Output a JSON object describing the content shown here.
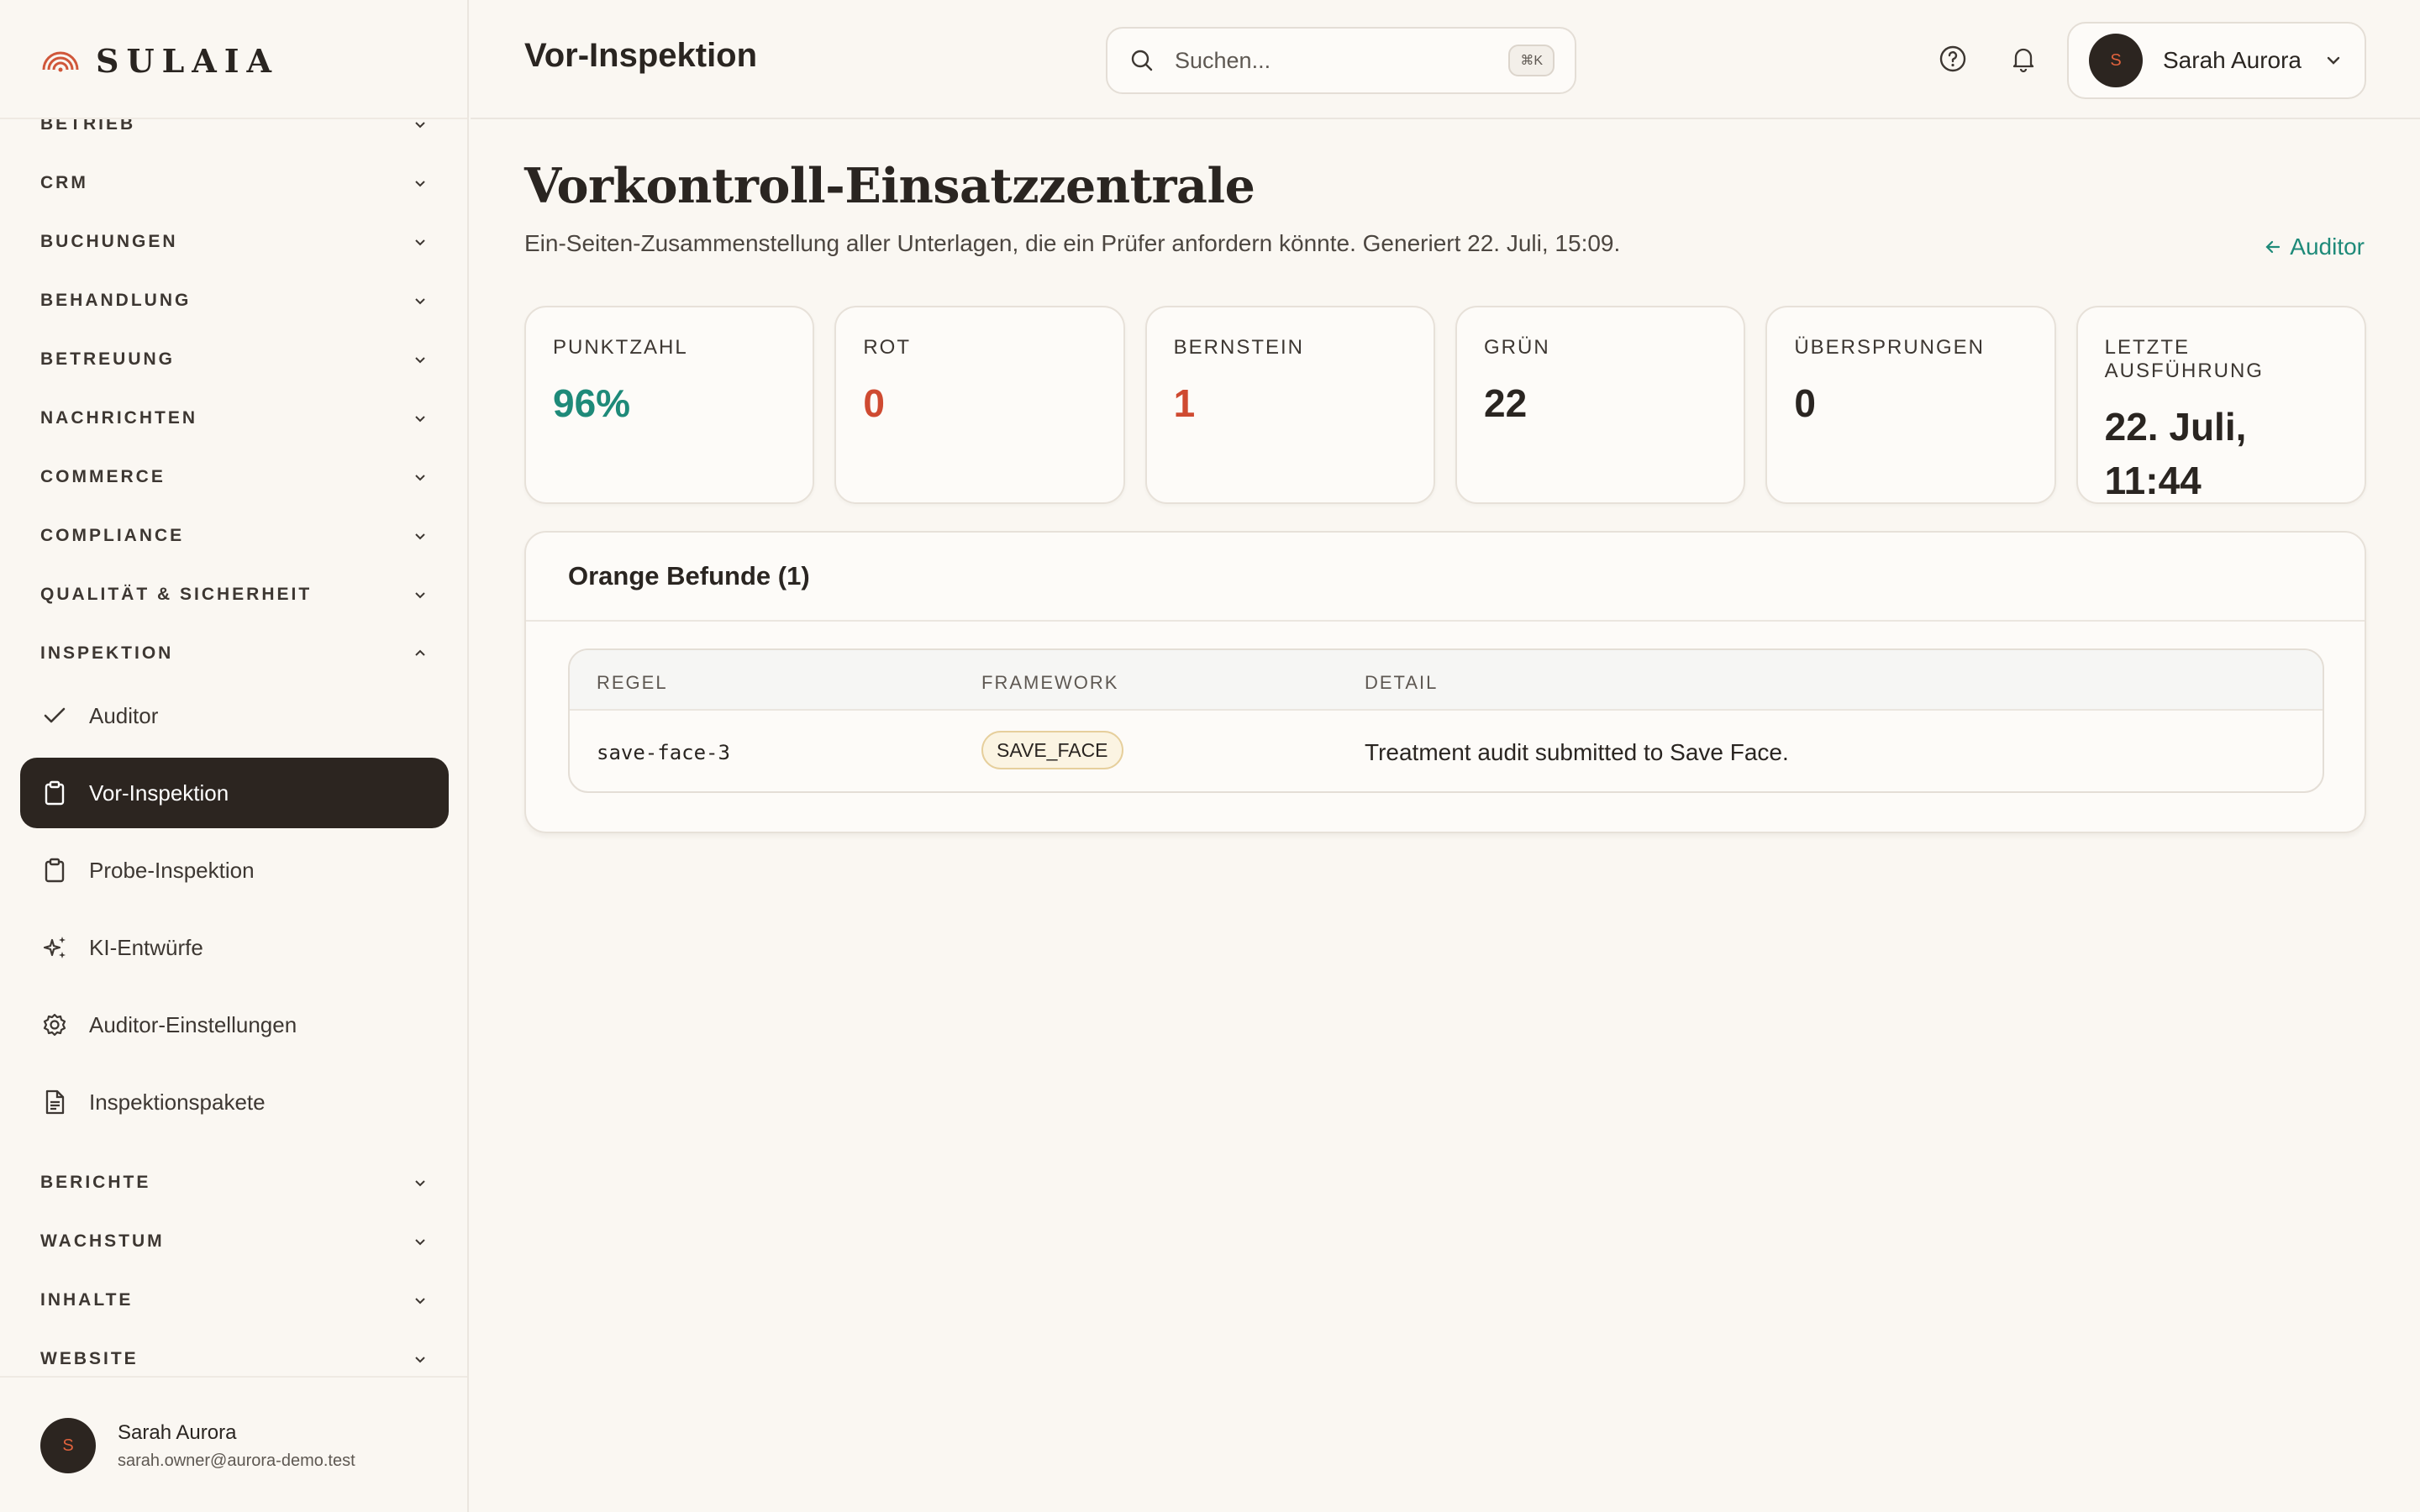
{
  "brand": {
    "name": "SULAIA"
  },
  "sidebar": {
    "sections": [
      {
        "label": "BETRIEB",
        "expanded": false
      },
      {
        "label": "CRM",
        "expanded": false
      },
      {
        "label": "BUCHUNGEN",
        "expanded": false
      },
      {
        "label": "BEHANDLUNG",
        "expanded": false
      },
      {
        "label": "BETREUUNG",
        "expanded": false
      },
      {
        "label": "NACHRICHTEN",
        "expanded": false
      },
      {
        "label": "COMMERCE",
        "expanded": false
      },
      {
        "label": "COMPLIANCE",
        "expanded": false
      },
      {
        "label": "QUALITÄT & SICHERHEIT",
        "expanded": false
      },
      {
        "label": "INSPEKTION",
        "expanded": true
      },
      {
        "label": "BERICHTE",
        "expanded": false
      },
      {
        "label": "WACHSTUM",
        "expanded": false
      },
      {
        "label": "INHALTE",
        "expanded": false
      },
      {
        "label": "WEBSITE",
        "expanded": false
      }
    ],
    "inspektion_items": [
      {
        "label": "Auditor",
        "icon": "check-icon",
        "active": false
      },
      {
        "label": "Vor-Inspektion",
        "icon": "clipboard-icon",
        "active": true
      },
      {
        "label": "Probe-Inspektion",
        "icon": "clipboard-icon",
        "active": false
      },
      {
        "label": "KI-Entwürfe",
        "icon": "sparkles-icon",
        "active": false
      },
      {
        "label": "Auditor-Einstellungen",
        "icon": "gear-icon",
        "active": false
      },
      {
        "label": "Inspektionspakete",
        "icon": "document-icon",
        "active": false
      }
    ],
    "user": {
      "initial": "S",
      "name": "Sarah Aurora",
      "email": "sarah.owner@aurora-demo.test"
    }
  },
  "header": {
    "title": "Vor-Inspektion",
    "search": {
      "placeholder": "Suchen...",
      "shortcut": "⌘K"
    },
    "user": {
      "initial": "S",
      "name": "Sarah Aurora"
    }
  },
  "main": {
    "title": "Vorkontroll-Einsatzzentrale",
    "subtitle": "Ein-Seiten-Zusammenstellung aller Unterlagen, die ein Prüfer anfordern könnte. Generiert 22. Juli, 15:09.",
    "back_link": "Auditor",
    "stats": [
      {
        "label": "PUNKTZAHL",
        "value": "96%",
        "tone": "teal"
      },
      {
        "label": "ROT",
        "value": "0",
        "tone": "red"
      },
      {
        "label": "BERNSTEIN",
        "value": "1",
        "tone": "red"
      },
      {
        "label": "GRÜN",
        "value": "22",
        "tone": "dark"
      },
      {
        "label": "ÜBERSPRUNGEN",
        "value": "0",
        "tone": "dark"
      },
      {
        "label": "LETZTE AUSFÜHRUNG",
        "value": "22. Juli, 11:44",
        "tone": "dark"
      }
    ],
    "findings": {
      "title": "Orange Befunde (1)",
      "columns": [
        "REGEL",
        "FRAMEWORK",
        "DETAIL"
      ],
      "rows": [
        {
          "rule": "save-face-3",
          "framework": "SAVE_FACE",
          "detail": "Treatment audit submitted to Save Face."
        }
      ]
    }
  },
  "colors": {
    "accent_teal": "#1e8a79",
    "alert_red": "#cf4a31",
    "active_nav_bg": "#2c2520",
    "brand_orange": "#d0573a"
  }
}
